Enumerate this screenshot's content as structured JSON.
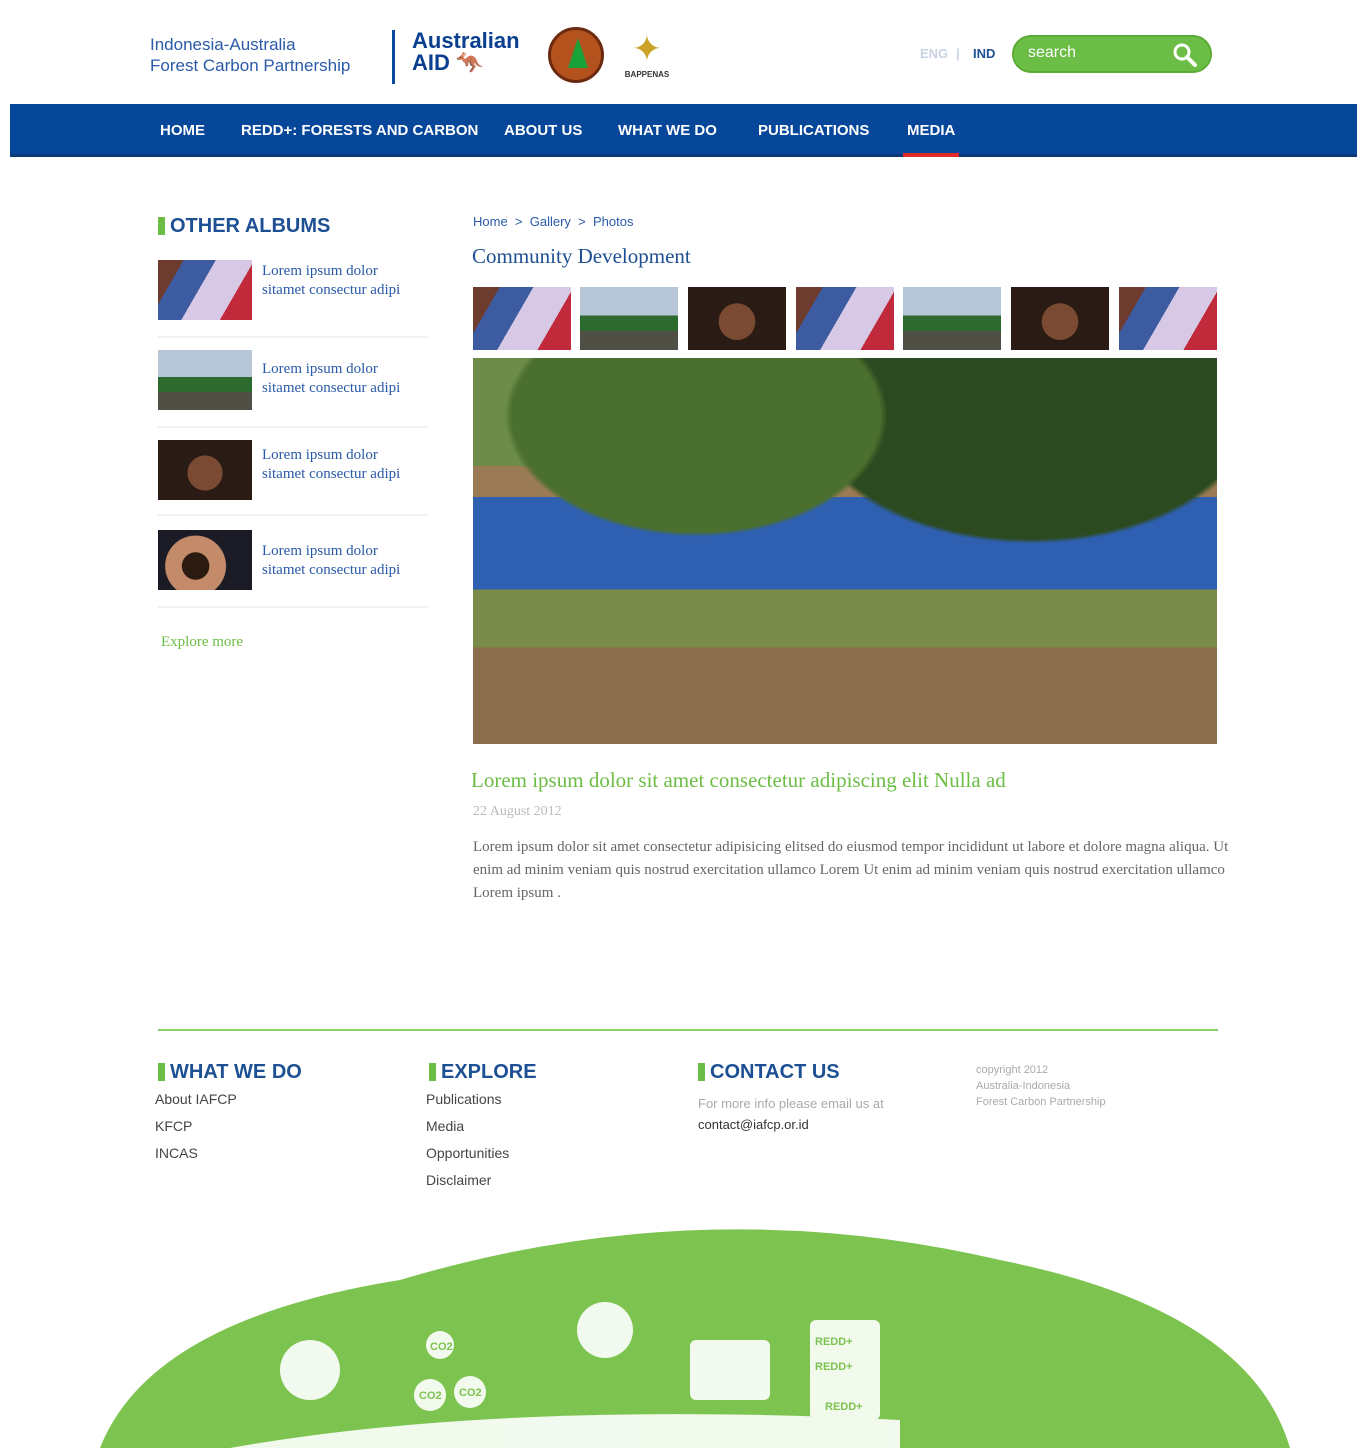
{
  "header": {
    "brand_line1": "Indonesia-Australia",
    "brand_line2": "Forest Carbon Partnership",
    "aid_line1": "Australian",
    "aid_line2": "AID",
    "bappenas": "BAPPENAS",
    "lang_eng": "ENG",
    "lang_sep": "|",
    "lang_ind": "IND",
    "search_placeholder": "search"
  },
  "nav": [
    "HOME",
    "REDD+: FORESTS AND CARBON",
    "ABOUT US",
    "WHAT WE DO",
    "PUBLICATIONS",
    "MEDIA"
  ],
  "sidebar": {
    "title": "OTHER ALBUMS",
    "albums": [
      {
        "l1": "Lorem ipsum dolor",
        "l2": "sitamet consectur adipi"
      },
      {
        "l1": "Lorem ipsum dolor",
        "l2": "sitamet consectur adipi"
      },
      {
        "l1": "Lorem ipsum dolor",
        "l2": "sitamet consectur adipi"
      },
      {
        "l1": "Lorem ipsum dolor",
        "l2": "sitamet consectur adipi"
      }
    ],
    "explore": "Explore more"
  },
  "breadcrumb": [
    "Home",
    ">",
    "Gallery",
    ">",
    "Photos"
  ],
  "album_title": "Community Development",
  "article": {
    "title": "Lorem ipsum dolor sit amet consectetur adipiscing elit Nulla ad",
    "date": "22 August 2012",
    "body": "Lorem ipsum dolor sit amet consectetur adipisicing elitsed do eiusmod tempor incididunt ut labore et dolore magna aliqua. Ut enim ad minim veniam quis nostrud exercitation ullamco Lorem Ut enim ad minim veniam quis nostrud exercitation ullamco Lorem ipsum ."
  },
  "footer": {
    "what_title": "WHAT WE DO",
    "what": [
      "About IAFCP",
      "KFCP",
      "INCAS"
    ],
    "explore_title": "EXPLORE",
    "explore": [
      "Publications",
      "Media",
      "Opportunities",
      "Disclaimer"
    ],
    "contact_title": "CONTACT US",
    "contact_text": "For more info please email us at",
    "contact_email": "contact@iafcp.or.id",
    "copy1": "copyright 2012",
    "copy2": "Australia-Indonesia",
    "copy3": "Forest Carbon Partnership",
    "art_labels": [
      "CO2",
      "CO2",
      "CO2",
      "REDD+",
      "REDD+",
      "REDD+"
    ]
  },
  "colors": {
    "blue": "#06479a",
    "green": "#6cbd45",
    "red": "#e02a2a"
  }
}
